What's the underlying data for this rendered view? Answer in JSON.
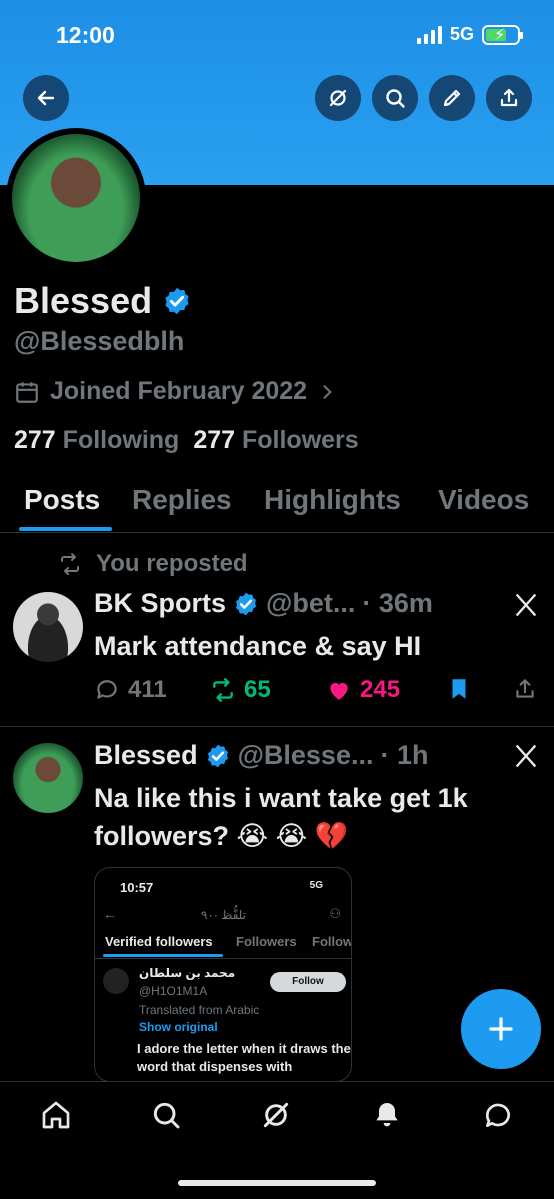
{
  "status_bar": {
    "time": "12:00",
    "network": "5G"
  },
  "profile": {
    "name": "Blessed",
    "handle": "@Blessedblh",
    "joined": "Joined February 2022",
    "following_count": "277",
    "following_label": "Following",
    "followers_count": "277",
    "followers_label": "Followers"
  },
  "tabs": [
    {
      "label": "Posts",
      "active": true
    },
    {
      "label": "Replies"
    },
    {
      "label": "Highlights"
    },
    {
      "label": "Videos"
    }
  ],
  "posts": [
    {
      "repost_label": "You reposted",
      "author": "BK Sports",
      "handle": "@bet...",
      "time": "· 36m",
      "text": "Mark attendance & say HI",
      "replies": "411",
      "reposts": "65",
      "likes": "245"
    },
    {
      "author": "Blessed",
      "handle": "@Blesse...",
      "time": "· 1h",
      "text": "Na like this i want take get 1k followers? 😭 😭 💔",
      "embed": {
        "time": "10:57",
        "status": "5G",
        "title": "تلفُّظ ·٩٠",
        "tabs": [
          "Verified followers",
          "Followers",
          "Follow"
        ],
        "user_name": "محمد بن سلطان",
        "user_handle": "@H1O1M1A",
        "follow_label": "Follow",
        "translated": "Translated from Arabic",
        "show_original": "Show original",
        "body": "I adore the letter when it draws the word that dispenses with"
      }
    }
  ],
  "colors": {
    "accent": "#1d9bf0",
    "repost": "#00ba7c",
    "like": "#f91880",
    "muted": "#71767b"
  },
  "icons": [
    "back-icon",
    "grok-icon",
    "search-icon",
    "edit-icon",
    "share-icon",
    "calendar-icon",
    "chevron-right-icon",
    "verified-icon",
    "repost-icon",
    "reply-icon",
    "like-icon",
    "bookmark-icon",
    "x-logo-icon",
    "plus-icon",
    "home-icon",
    "bell-icon",
    "message-icon"
  ]
}
